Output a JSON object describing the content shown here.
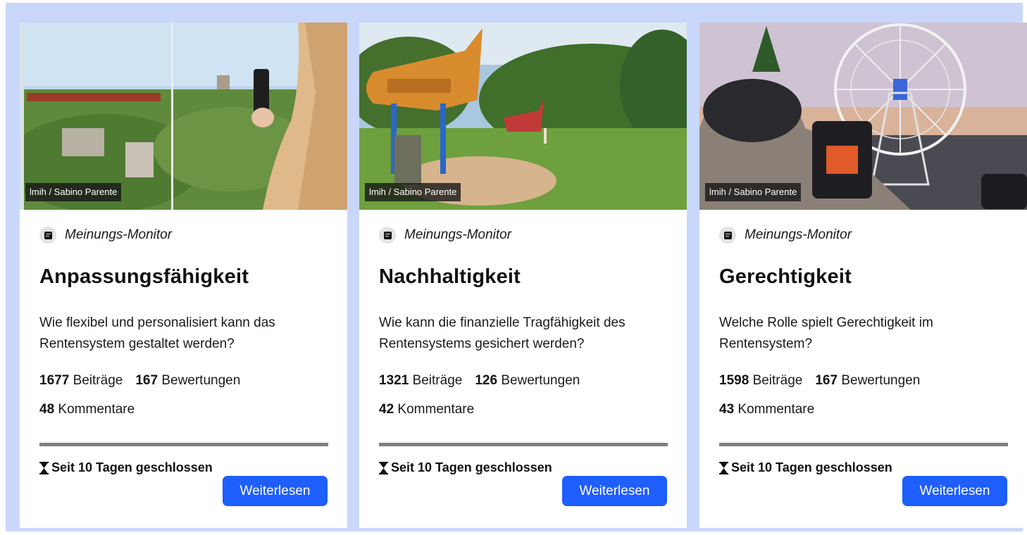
{
  "cards": [
    {
      "credit": "lmih / Sabino Parente",
      "source": "Meinungs-Monitor",
      "title": "Anpassungsfähigkeit",
      "question": "Wie flexibel und personalisiert kann das Rentensystem gestaltet werden?",
      "contributions": "1677",
      "contributions_label": "Beiträge",
      "ratings": "167",
      "ratings_label": "Bewertungen",
      "comments": "48",
      "comments_label": "Kommentare",
      "status": "Seit 10 Tagen geschlossen",
      "button": "Weiterlesen"
    },
    {
      "credit": "lmih / Sabino Parente",
      "source": "Meinungs-Monitor",
      "title": "Nachhaltigkeit",
      "question": "Wie kann die finanzielle Tragfähigkeit des Rentensystems gesichert werden?",
      "contributions": "1321",
      "contributions_label": "Beiträge",
      "ratings": "126",
      "ratings_label": "Bewertungen",
      "comments": "42",
      "comments_label": "Kommentare",
      "status": "Seit 10 Tagen geschlossen",
      "button": "Weiterlesen"
    },
    {
      "credit": "lmih / Sabino Parente",
      "source": "Meinungs-Monitor",
      "title": "Gerechtigkeit",
      "question": "Welche Rolle spielt Gerechtigkeit im Rentensystem?",
      "contributions": "1598",
      "contributions_label": "Beiträge",
      "ratings": "167",
      "ratings_label": "Bewertungen",
      "comments": "43",
      "comments_label": "Kommentare",
      "status": "Seit 10 Tagen geschlossen",
      "button": "Weiterlesen"
    }
  ],
  "colors": {
    "page_background": "#c9d7fb",
    "button": "#1f5eff",
    "divider": "#7f7f7f"
  },
  "icons": {
    "source": "opinion-monitor-icon",
    "status": "hourglass-icon"
  }
}
